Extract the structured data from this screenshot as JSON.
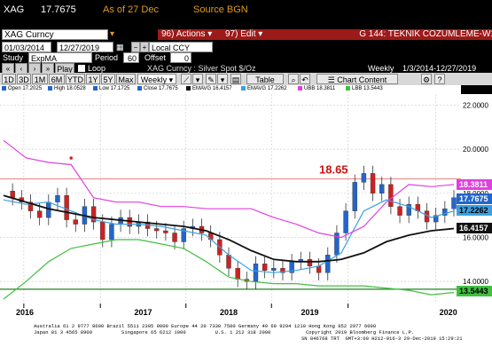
{
  "ticker": {
    "symbol": "XAG",
    "price": "17.7675",
    "as_of": "As of 27 Dec",
    "source": "Source BGN"
  },
  "toolbar_row": {
    "security": "XAG Curncy",
    "actions_num": "96)",
    "actions_label": "Actions",
    "edit_num": "97)",
    "edit_label": "Edit",
    "page_title": "G 144: TEKNIK COZUMLEME-W1"
  },
  "settings_row": {
    "date_start": "01/03/2014",
    "date_end": "12/27/2019",
    "currency": "Local CCY",
    "study_label": "Study",
    "study_value": "ExpMA",
    "period_label": "Period",
    "period_value": "60",
    "offset_label": "Offset",
    "offset_value": "0",
    "play_label": "Play",
    "loop_label": "Loop",
    "chart_desc": "XAG Curncy : Silver Spot $/Oz",
    "frequency": "Weekly",
    "range": "1/3/2014-12/27/2019"
  },
  "range_tabs": [
    "1D",
    "3D",
    "1M",
    "6M",
    "YTD",
    "1Y",
    "5Y",
    "Max"
  ],
  "range_period": "Weekly",
  "table_label": "Table",
  "chart_content_label": "Chart Content",
  "legend": [
    {
      "label": "Open 17.2025",
      "color": "#2266cc"
    },
    {
      "label": "High 18.0528",
      "color": "#2266cc"
    },
    {
      "label": "Low 17.1725",
      "color": "#2266cc"
    },
    {
      "label": "Close 17.7675",
      "color": "#2266cc"
    },
    {
      "label": "EMAVG 16.4157",
      "color": "#111111"
    },
    {
      "label": "EMAVG 17.2262",
      "color": "#3aa0e0"
    },
    {
      "label": "UBB 18.3811",
      "color": "#e040e0"
    },
    {
      "label": "LBB 13.5443",
      "color": "#40c040"
    }
  ],
  "price_boxes": [
    {
      "value": "18.3811",
      "color": "#e040e0",
      "text": "#ffffff"
    },
    {
      "value": "17.7675",
      "color": "#2266cc",
      "text": "#ffffff"
    },
    {
      "value": "17.2262",
      "color": "#3aa0e0",
      "text": "#000000"
    },
    {
      "value": "16.4157",
      "color": "#111111",
      "text": "#ffffff"
    },
    {
      "value": "13.5443",
      "color": "#40c040",
      "text": "#000000"
    }
  ],
  "annotation": "18.65",
  "chart_data": {
    "type": "line",
    "title": "XAG Curncy : Silver Spot $/Oz",
    "ylim": [
      13.0,
      22.5
    ],
    "y_ticks": [
      "22.0000",
      "20.0000",
      "18.0000",
      "16.0000",
      "14.0000"
    ],
    "x_labels": [
      "2016",
      "2017",
      "2018",
      "2019",
      "2020"
    ],
    "hline_value": 18.65,
    "support_value": 13.65,
    "series": [
      {
        "name": "Close",
        "color": "#2266cc",
        "x": [
          0,
          2,
          4,
          6,
          8,
          10,
          12,
          14,
          16,
          18,
          20,
          22,
          24,
          26,
          28,
          30,
          32,
          34,
          36,
          38,
          40,
          42,
          44,
          46,
          48,
          50,
          52,
          54,
          56,
          58,
          60,
          62,
          64,
          66,
          68,
          70,
          72,
          74,
          76,
          78,
          80,
          82,
          84,
          86,
          88,
          90,
          92,
          94,
          96,
          98,
          100
        ],
        "values": [
          18.1,
          17.8,
          17.6,
          17.2,
          16.9,
          17.6,
          17.9,
          16.8,
          16.6,
          17.4,
          16.7,
          15.9,
          16.6,
          16.9,
          16.5,
          16.7,
          16.4,
          16.3,
          16.2,
          15.8,
          16.4,
          16.5,
          16.2,
          15.9,
          15.2,
          14.6,
          14.1,
          14.0,
          14.8,
          14.5,
          14.6,
          14.4,
          14.9,
          15.0,
          14.7,
          14.4,
          15.2,
          16.2,
          17.2,
          18.5,
          18.9,
          18.0,
          18.4,
          17.4,
          17.0,
          17.5,
          17.2,
          16.7,
          17.0,
          17.3,
          17.8
        ]
      },
      {
        "name": "EMAVG",
        "color": "#3aa0e0",
        "x": [
          0,
          5,
          10,
          15,
          20,
          25,
          30,
          35,
          40,
          45,
          50,
          55,
          60,
          65,
          70,
          75,
          80,
          85,
          90,
          95,
          100
        ],
        "values": [
          17.7,
          17.5,
          17.6,
          17.2,
          16.8,
          16.6,
          16.6,
          16.5,
          16.3,
          16.1,
          15.2,
          14.5,
          14.4,
          14.5,
          14.7,
          15.3,
          17.2,
          17.7,
          17.4,
          16.9,
          17.2
        ]
      },
      {
        "name": "EMAVG",
        "color": "#111111",
        "x": [
          0,
          5,
          10,
          15,
          20,
          25,
          30,
          35,
          40,
          45,
          50,
          55,
          60,
          65,
          70,
          75,
          80,
          85,
          90,
          95,
          100
        ],
        "values": [
          17.9,
          17.6,
          17.3,
          17.1,
          16.9,
          16.8,
          16.7,
          16.6,
          16.5,
          16.3,
          15.9,
          15.4,
          15.0,
          14.9,
          14.9,
          15.0,
          15.3,
          15.8,
          16.1,
          16.3,
          16.4
        ]
      },
      {
        "name": "UBB",
        "color": "#e040e0",
        "x": [
          0,
          5,
          10,
          15,
          20,
          25,
          30,
          35,
          40,
          45,
          50,
          55,
          60,
          65,
          70,
          75,
          80,
          85,
          90,
          95,
          100
        ],
        "values": [
          20.4,
          19.6,
          19.4,
          19.3,
          17.8,
          17.6,
          17.6,
          17.4,
          17.4,
          17.3,
          17.3,
          17.3,
          16.9,
          16.6,
          16.2,
          16.0,
          16.5,
          17.6,
          18.4,
          18.3,
          18.4
        ]
      },
      {
        "name": "LBB",
        "color": "#40c040",
        "x": [
          0,
          5,
          10,
          15,
          20,
          25,
          30,
          35,
          40,
          45,
          50,
          55,
          60,
          65,
          70,
          75,
          80,
          85,
          90,
          95,
          100
        ],
        "values": [
          13.2,
          14.0,
          14.9,
          15.5,
          15.7,
          15.9,
          15.9,
          15.7,
          15.5,
          14.9,
          14.2,
          14.0,
          13.9,
          13.9,
          13.8,
          13.8,
          13.8,
          13.7,
          13.6,
          13.4,
          13.5
        ]
      }
    ]
  },
  "footer_lines": [
    "Australia 61 2 9777 8600 Brazil 5511 2395 9000 Europe 44 20 7330 7500 Germany 49 69 9204 1210 Hong Kong 852 2977 6000",
    "Japan 81 3 4565 8900          Singapore 65 6212 1000          U.S. 1 212 318 2000            Copyright 2019 Bloomberg Finance L.P.",
    "SN 846768 TRT  GMT+3:00 H212-916-3 29-Dec-2019 15:29:21"
  ]
}
